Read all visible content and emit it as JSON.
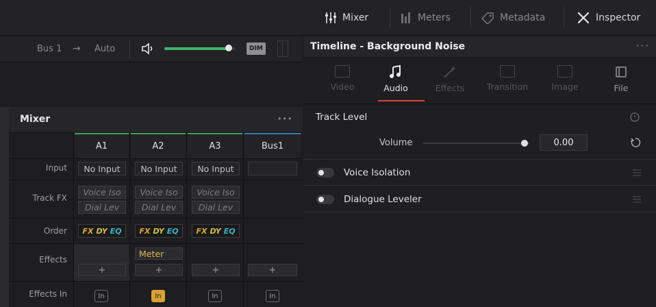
{
  "topbar": {
    "mixer": "Mixer",
    "meters": "Meters",
    "metadata": "Metadata",
    "inspector": "Inspector"
  },
  "bus": {
    "name": "Bus 1",
    "arrow": "→",
    "mode": "Auto",
    "dim": "DIM",
    "volume_fraction": 0.9
  },
  "mixer": {
    "title": "Mixer",
    "more": "•••",
    "columns": [
      {
        "label": "A1",
        "color": "#3aa36b"
      },
      {
        "label": "A2",
        "color": "#3aa36b"
      },
      {
        "label": "A3",
        "color": "#3aa36b"
      },
      {
        "label": "Bus1",
        "color": "#2f7fb8"
      }
    ],
    "row_labels": {
      "input": "Input",
      "track_fx": "Track FX",
      "order": "Order",
      "effects": "Effects",
      "effects_in": "Effects In"
    },
    "input": [
      "No Input",
      "No Input",
      "No Input",
      ""
    ],
    "fx1": [
      "Voice Iso",
      "Voice Iso",
      "Voice Iso"
    ],
    "fx2": [
      "Dial Lev",
      "Dial Lev",
      "Dial Lev"
    ],
    "order": {
      "fx": "FX",
      "dy": "DY",
      "eq": "EQ"
    },
    "effect_a2": "Meter",
    "plus": "+",
    "in": "In"
  },
  "inspector": {
    "title": "Timeline - Background Noise",
    "more": "•••",
    "tabs": [
      {
        "label": "Video",
        "active": false
      },
      {
        "label": "Audio",
        "active": true
      },
      {
        "label": "Effects",
        "active": false
      },
      {
        "label": "Transition",
        "active": false
      },
      {
        "label": "Image",
        "active": false
      },
      {
        "label": "File",
        "active": false
      }
    ],
    "track_level": "Track Level",
    "volume_label": "Volume",
    "volume_value": "0.00",
    "voice_isolation": "Voice Isolation",
    "dialogue_leveler": "Dialogue Leveler",
    "accent": "#d8423c"
  }
}
